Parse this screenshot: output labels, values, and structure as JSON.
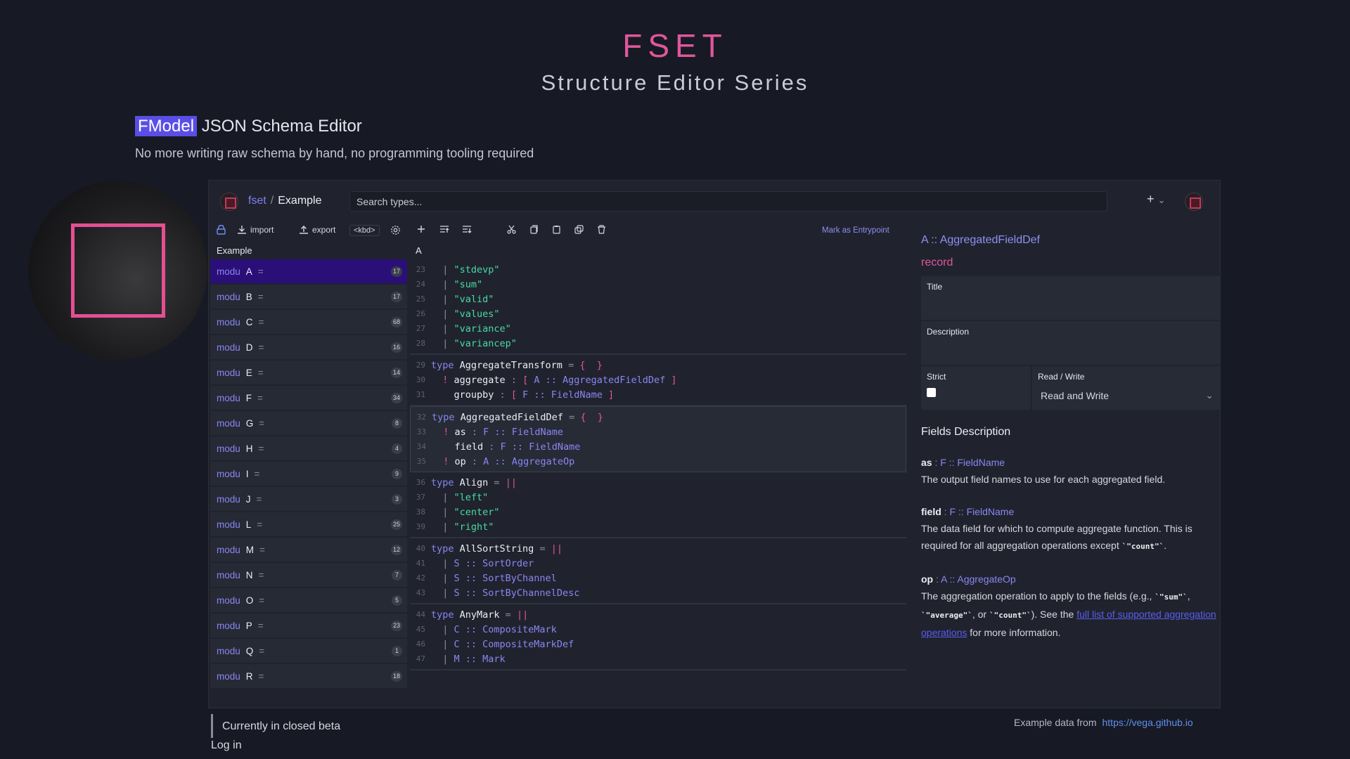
{
  "hero": {
    "title": "FSET",
    "subtitle": "Structure Editor Series"
  },
  "product": {
    "highlight": "FModel",
    "name": "JSON Schema Editor",
    "tagline": "No more writing raw schema by hand, no programming tooling required"
  },
  "topbar": {
    "crumb_root": "fset",
    "crumb_sep": "/",
    "crumb_current": "Example",
    "search_placeholder": "Search types...",
    "plus": "+",
    "chevron": "⌄"
  },
  "toolbar": {
    "import": "import",
    "export": "export",
    "kbd": "<kbd>",
    "mark_entry": "Mark as Entrypoint"
  },
  "sidebar": {
    "header": "Example",
    "modules": [
      {
        "kw": "modu",
        "name": "A",
        "eq": "=",
        "count": "17"
      },
      {
        "kw": "modu",
        "name": "B",
        "eq": "=",
        "count": "17"
      },
      {
        "kw": "modu",
        "name": "C",
        "eq": "=",
        "count": "68"
      },
      {
        "kw": "modu",
        "name": "D",
        "eq": "=",
        "count": "16"
      },
      {
        "kw": "modu",
        "name": "E",
        "eq": "=",
        "count": "14"
      },
      {
        "kw": "modu",
        "name": "F",
        "eq": "=",
        "count": "34"
      },
      {
        "kw": "modu",
        "name": "G",
        "eq": "=",
        "count": "8"
      },
      {
        "kw": "modu",
        "name": "H",
        "eq": "=",
        "count": "4"
      },
      {
        "kw": "modu",
        "name": "I",
        "eq": "=",
        "count": "9"
      },
      {
        "kw": "modu",
        "name": "J",
        "eq": "=",
        "count": "3"
      },
      {
        "kw": "modu",
        "name": "L",
        "eq": "=",
        "count": "25"
      },
      {
        "kw": "modu",
        "name": "M",
        "eq": "=",
        "count": "12"
      },
      {
        "kw": "modu",
        "name": "N",
        "eq": "=",
        "count": "7"
      },
      {
        "kw": "modu",
        "name": "O",
        "eq": "=",
        "count": "5"
      },
      {
        "kw": "modu",
        "name": "P",
        "eq": "=",
        "count": "23"
      },
      {
        "kw": "modu",
        "name": "Q",
        "eq": "=",
        "count": "1"
      },
      {
        "kw": "modu",
        "name": "R",
        "eq": "=",
        "count": "18"
      }
    ]
  },
  "code": {
    "header": "A",
    "blocks": [
      {
        "lines": [
          {
            "n": "23",
            "t": [
              [
                "pipe",
                "  | "
              ],
              [
                "str",
                "\"stdevp\""
              ]
            ]
          },
          {
            "n": "24",
            "t": [
              [
                "pipe",
                "  | "
              ],
              [
                "str",
                "\"sum\""
              ]
            ]
          },
          {
            "n": "25",
            "t": [
              [
                "pipe",
                "  | "
              ],
              [
                "str",
                "\"valid\""
              ]
            ]
          },
          {
            "n": "26",
            "t": [
              [
                "pipe",
                "  | "
              ],
              [
                "str",
                "\"values\""
              ]
            ]
          },
          {
            "n": "27",
            "t": [
              [
                "pipe",
                "  | "
              ],
              [
                "str",
                "\"variance\""
              ]
            ]
          },
          {
            "n": "28",
            "t": [
              [
                "pipe",
                "  | "
              ],
              [
                "str",
                "\"variancep\""
              ]
            ]
          }
        ]
      },
      {
        "lines": [
          {
            "n": "29",
            "t": [
              [
                "kw",
                "type "
              ],
              [
                "nm",
                "AggregateTransform "
              ],
              [
                "pipe",
                "= "
              ],
              [
                "pun",
                "{  }"
              ]
            ]
          },
          {
            "n": "30",
            "t": [
              [
                "pun",
                "  ! "
              ],
              [
                "nm",
                "aggregate "
              ],
              [
                "pipe",
                ": "
              ],
              [
                "pun",
                "[ "
              ],
              [
                "ref",
                "A :: AggregatedFieldDef "
              ],
              [
                "pun",
                "]"
              ]
            ]
          },
          {
            "n": "31",
            "t": [
              [
                "nm",
                "    groupby "
              ],
              [
                "pipe",
                ": "
              ],
              [
                "pun",
                "[ "
              ],
              [
                "ref",
                "F :: FieldName "
              ],
              [
                "pun",
                "]"
              ]
            ]
          }
        ]
      },
      {
        "sel": true,
        "lines": [
          {
            "n": "32",
            "t": [
              [
                "kw",
                "type "
              ],
              [
                "nm",
                "AggregatedFieldDef "
              ],
              [
                "pipe",
                "= "
              ],
              [
                "pun",
                "{  }"
              ]
            ]
          },
          {
            "n": "33",
            "t": [
              [
                "pun",
                "  ! "
              ],
              [
                "nm",
                "as "
              ],
              [
                "pipe",
                ": "
              ],
              [
                "ref",
                "F :: FieldName"
              ]
            ]
          },
          {
            "n": "34",
            "t": [
              [
                "nm",
                "    field "
              ],
              [
                "pipe",
                ": "
              ],
              [
                "ref",
                "F :: FieldName"
              ]
            ]
          },
          {
            "n": "35",
            "t": [
              [
                "pun",
                "  ! "
              ],
              [
                "nm",
                "op "
              ],
              [
                "pipe",
                ": "
              ],
              [
                "ref",
                "A :: AggregateOp"
              ]
            ]
          }
        ]
      },
      {
        "lines": [
          {
            "n": "36",
            "t": [
              [
                "kw",
                "type "
              ],
              [
                "nm",
                "Align "
              ],
              [
                "pipe",
                "= "
              ],
              [
                "pun",
                "||"
              ]
            ]
          },
          {
            "n": "37",
            "t": [
              [
                "pipe",
                "  | "
              ],
              [
                "str",
                "\"left\""
              ]
            ]
          },
          {
            "n": "38",
            "t": [
              [
                "pipe",
                "  | "
              ],
              [
                "str",
                "\"center\""
              ]
            ]
          },
          {
            "n": "39",
            "t": [
              [
                "pipe",
                "  | "
              ],
              [
                "str",
                "\"right\""
              ]
            ]
          }
        ]
      },
      {
        "lines": [
          {
            "n": "40",
            "t": [
              [
                "kw",
                "type "
              ],
              [
                "nm",
                "AllSortString "
              ],
              [
                "pipe",
                "= "
              ],
              [
                "pun",
                "||"
              ]
            ]
          },
          {
            "n": "41",
            "t": [
              [
                "pipe",
                "  | "
              ],
              [
                "ref",
                "S :: SortOrder"
              ]
            ]
          },
          {
            "n": "42",
            "t": [
              [
                "pipe",
                "  | "
              ],
              [
                "ref",
                "S :: SortByChannel"
              ]
            ]
          },
          {
            "n": "43",
            "t": [
              [
                "pipe",
                "  | "
              ],
              [
                "ref",
                "S :: SortByChannelDesc"
              ]
            ]
          }
        ]
      },
      {
        "lines": [
          {
            "n": "44",
            "t": [
              [
                "kw",
                "type "
              ],
              [
                "nm",
                "AnyMark "
              ],
              [
                "pipe",
                "= "
              ],
              [
                "pun",
                "||"
              ]
            ]
          },
          {
            "n": "45",
            "t": [
              [
                "pipe",
                "  | "
              ],
              [
                "ref",
                "C :: CompositeMark"
              ]
            ]
          },
          {
            "n": "46",
            "t": [
              [
                "pipe",
                "  | "
              ],
              [
                "ref",
                "C :: CompositeMarkDef"
              ]
            ]
          },
          {
            "n": "47",
            "t": [
              [
                "pipe",
                "  | "
              ],
              [
                "ref",
                "M :: Mark"
              ]
            ]
          }
        ]
      }
    ]
  },
  "panel": {
    "ref": "A :: AggregatedFieldDef",
    "kind": "record",
    "title_label": "Title",
    "desc_label": "Description",
    "strict_label": "Strict",
    "rw_label": "Read / Write",
    "rw_value": "Read and Write",
    "fields_title": "Fields Description",
    "fields": [
      {
        "name": "as",
        "type": "F :: FieldName",
        "desc": "The output field names to use for each aggregated field."
      },
      {
        "name": "field",
        "type": "F :: FieldName",
        "desc_a": "The data field for which to compute aggregate function. This is required for all aggregation operations except ",
        "code": "`\"count\"`",
        "desc_b": "."
      },
      {
        "name": "op",
        "type": "A :: AggregateOp",
        "desc_a": "The aggregation operation to apply to the fields (e.g., ",
        "c1": "`\"sum\"`",
        "s1": ", ",
        "c2": "`\"average\"`",
        "s2": ", or ",
        "c3": "`\"count\"`",
        "s3": "). See the ",
        "link": "full list of supported aggregation operations",
        "desc_b": " for more information."
      }
    ]
  },
  "footer": {
    "beta": "Currently in closed beta",
    "login": "Log in",
    "credit": "Example data from",
    "credit_url": "https://vega.github.io"
  },
  "colors": {
    "accent": "#e0569c",
    "keyword": "#8a86f2",
    "string": "#49d9a4",
    "active": "#2b0f78"
  }
}
